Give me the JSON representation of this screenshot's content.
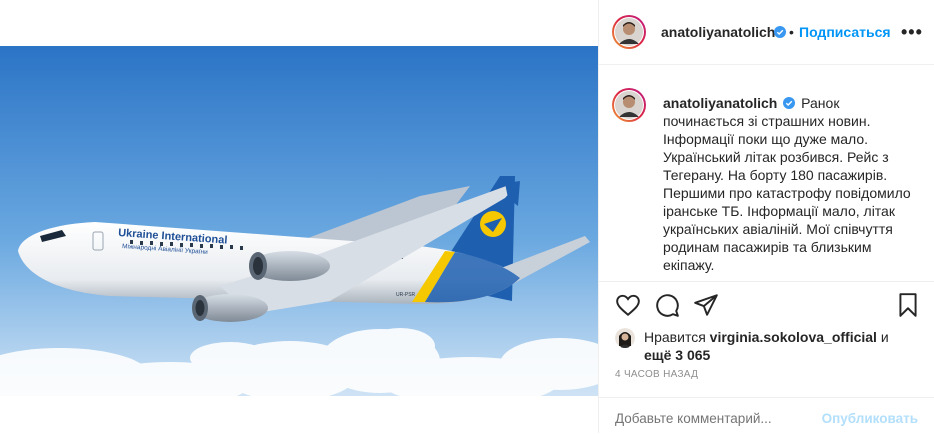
{
  "post": {
    "username": "anatoliyanatolich",
    "follow_label": "Подписаться",
    "dot": "•",
    "more_label": "•••",
    "caption_user": "anatoliyanatolich",
    "caption_text": "Ранок починається зі страшних новин. Інформації поки що дуже мало. Український літак розбився. Рейс з Тегерану. На борту 180 пасажирів. Першими про катастрофу повідомило іранське ТБ. Інформації мало, літак українських авіаліній. Мої співчуття родинам пасажирів та близьким екіпажу.",
    "likes_prefix": "Нравится",
    "likes_user": "virginia.sokolova_official",
    "likes_suffix": "и",
    "likes_more": "ещё 3 065",
    "time": "4 ЧАСОВ НАЗАД",
    "comment_placeholder": "Добавьте комментарий...",
    "publish_label": "Опубликовать"
  },
  "photo": {
    "livery_title": "Ukraine International",
    "livery_subtitle": "Міжнародні Авіалінії України",
    "registration": "UR-PSR"
  },
  "icons": {
    "verified": "verified-badge-icon",
    "like": "heart-icon",
    "comment": "comment-icon",
    "share": "paper-plane-icon",
    "save": "bookmark-icon"
  },
  "colors": {
    "accent": "#0095f6",
    "publish_disabled": "#b2dffc",
    "sky_top": "#2f7fd0",
    "livery_blue": "#1f5fb0",
    "livery_yellow": "#f5c800"
  }
}
